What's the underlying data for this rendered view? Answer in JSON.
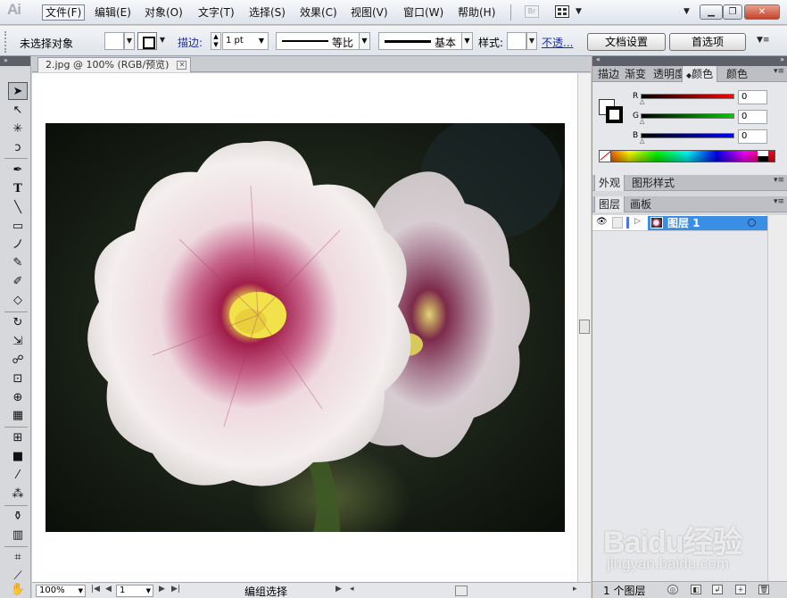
{
  "app": {
    "logo": "Ai"
  },
  "menubar": {
    "items": [
      "文件(F)",
      "编辑(E)",
      "对象(O)",
      "文字(T)",
      "选择(S)",
      "效果(C)",
      "视图(V)",
      "窗口(W)",
      "帮助(H)"
    ],
    "bridge_label": "Br"
  },
  "controlbar": {
    "selection_status": "未选择对象",
    "stroke_label": "描边:",
    "stroke_weight": "1 pt",
    "profile_label": "等比",
    "brush_label": "基本",
    "style_label": "样式:",
    "opacity_link": "不透...",
    "doc_setup_button": "文档设置",
    "preferences_button": "首选项"
  },
  "document": {
    "tab_title": "2.jpg @ 100% (RGB/预览)"
  },
  "statusbar": {
    "zoom": "100%",
    "page": "1",
    "status_text": "编组选择"
  },
  "color_panel": {
    "tabs": [
      "描边",
      "渐变",
      "透明度",
      "颜色",
      "颜色"
    ],
    "r_label": "R",
    "g_label": "G",
    "b_label": "B",
    "r_value": "0",
    "g_value": "0",
    "b_value": "0"
  },
  "appearance_panel": {
    "tabs": [
      "外观",
      "图形样式"
    ]
  },
  "layers_panel": {
    "tabs": [
      "图层",
      "画板"
    ],
    "layer_name": "图层 1",
    "layer_count": "1 个图层",
    "layer_color": "#4d74e8"
  },
  "watermark": {
    "logo": "Baidu经验",
    "url": "jingyan.baidu.com"
  }
}
